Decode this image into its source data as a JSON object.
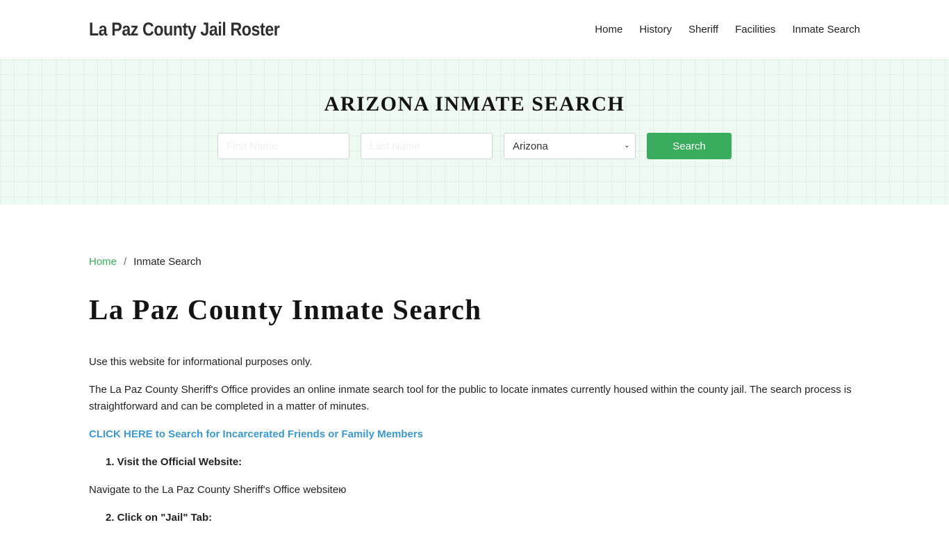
{
  "header": {
    "brand": "La Paz County Jail Roster",
    "nav": [
      "Home",
      "History",
      "Sheriff",
      "Facilities",
      "Inmate Search"
    ]
  },
  "hero": {
    "title": "ARIZONA INMATE SEARCH",
    "first_name_placeholder": "First Name",
    "last_name_placeholder": "Last Name",
    "state_selected": "Arizona",
    "search_label": "Search",
    "colors": {
      "accent": "#3aac5d",
      "hero_bg": "#eef9f1"
    }
  },
  "breadcrumb": {
    "home": "Home",
    "separator": "/",
    "current": "Inmate Search"
  },
  "main": {
    "title": "La Paz County Inmate Search",
    "intro": "Use this website for informational purposes only.",
    "description": "The La Paz County Sheriff's Office provides an online inmate search tool for the public to locate inmates currently housed within the county jail. The search process is straightforward and can be completed in a matter of minutes.",
    "cta_link": "CLICK HERE to Search for Incarcerated Friends or Family Members",
    "steps": [
      {
        "label": "1. Visit the Official Website:",
        "detail": "Navigate to the La Paz County Sheriff's Office websiteю"
      },
      {
        "label": "2. Click on \"Jail\" Tab:"
      }
    ]
  }
}
